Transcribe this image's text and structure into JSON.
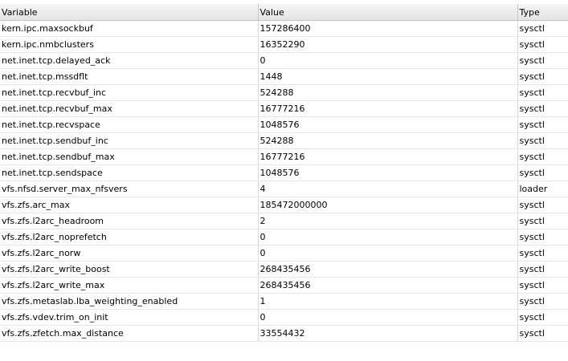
{
  "table": {
    "columns": [
      "Variable",
      "Value",
      "Type"
    ],
    "rows": [
      [
        "kern.ipc.maxsockbuf",
        "157286400",
        "sysctl"
      ],
      [
        "kern.ipc.nmbclusters",
        "16352290",
        "sysctl"
      ],
      [
        "net.inet.tcp.delayed_ack",
        "0",
        "sysctl"
      ],
      [
        "net.inet.tcp.mssdflt",
        "1448",
        "sysctl"
      ],
      [
        "net.inet.tcp.recvbuf_inc",
        "524288",
        "sysctl"
      ],
      [
        "net.inet.tcp.recvbuf_max",
        "16777216",
        "sysctl"
      ],
      [
        "net.inet.tcp.recvspace",
        "1048576",
        "sysctl"
      ],
      [
        "net.inet.tcp.sendbuf_inc",
        "524288",
        "sysctl"
      ],
      [
        "net.inet.tcp.sendbuf_max",
        "16777216",
        "sysctl"
      ],
      [
        "net.inet.tcp.sendspace",
        "1048576",
        "sysctl"
      ],
      [
        "vfs.nfsd.server_max_nfsvers",
        "4",
        "loader"
      ],
      [
        "vfs.zfs.arc_max",
        "185472000000",
        "sysctl"
      ],
      [
        "vfs.zfs.l2arc_headroom",
        "2",
        "sysctl"
      ],
      [
        "vfs.zfs.l2arc_noprefetch",
        "0",
        "sysctl"
      ],
      [
        "vfs.zfs.l2arc_norw",
        "0",
        "sysctl"
      ],
      [
        "vfs.zfs.l2arc_write_boost",
        "268435456",
        "sysctl"
      ],
      [
        "vfs.zfs.l2arc_write_max",
        "268435456",
        "sysctl"
      ],
      [
        "vfs.zfs.metaslab.lba_weighting_enabled",
        "1",
        "sysctl"
      ],
      [
        "vfs.zfs.vdev.trim_on_init",
        "0",
        "sysctl"
      ],
      [
        "vfs.zfs.zfetch.max_distance",
        "33554432",
        "sysctl"
      ]
    ]
  }
}
